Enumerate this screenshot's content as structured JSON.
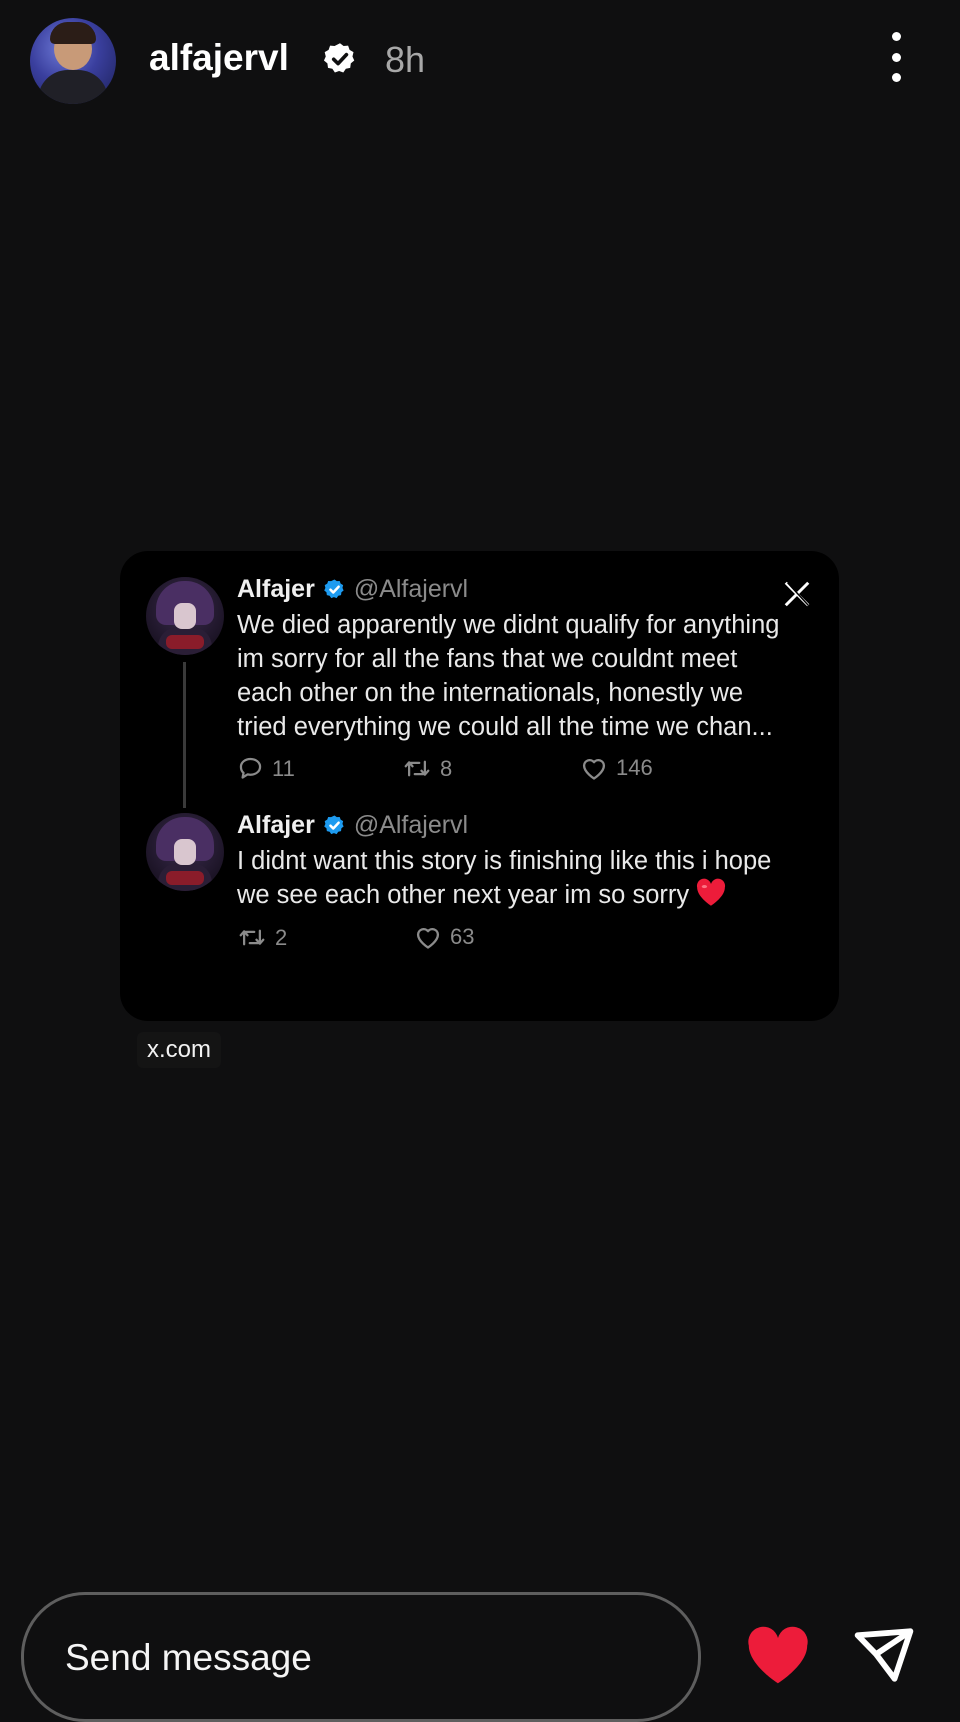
{
  "header": {
    "username": "alfajervl",
    "time": "8h",
    "avatar_icon": "profile-photo",
    "verified_icon": "verified-badge-icon",
    "more_icon": "more-vertical-icon"
  },
  "tweet_card": {
    "x_logo_icon": "x-logo-icon",
    "tweets": [
      {
        "name": "Alfajer",
        "handle": "@Alfajervl",
        "lines": [
          "We died apparently we didnt qualify for anything",
          "im sorry for all the fans that we couldnt meet",
          "each other on the internationals, honestly we",
          "tried everything we could all the time we chan..."
        ],
        "replies": "11",
        "reposts": "8",
        "likes": "146"
      },
      {
        "name": "Alfajer",
        "handle": "@Alfajervl",
        "lines": [
          "I didnt want this story is finishing like this i hope",
          "we see each other next year im so sorry"
        ],
        "reposts": "2",
        "likes": "63"
      }
    ]
  },
  "link": {
    "label": "x.com"
  },
  "footer": {
    "message_placeholder": "Send message",
    "like_icon": "heart-icon",
    "send_icon": "send-icon"
  },
  "colors": {
    "background": "#0f0f10",
    "card": "#000000",
    "verified_blue": "#1d9bf0",
    "heart_red": "#ed1c3a",
    "muted_text": "#8b8b8b"
  }
}
